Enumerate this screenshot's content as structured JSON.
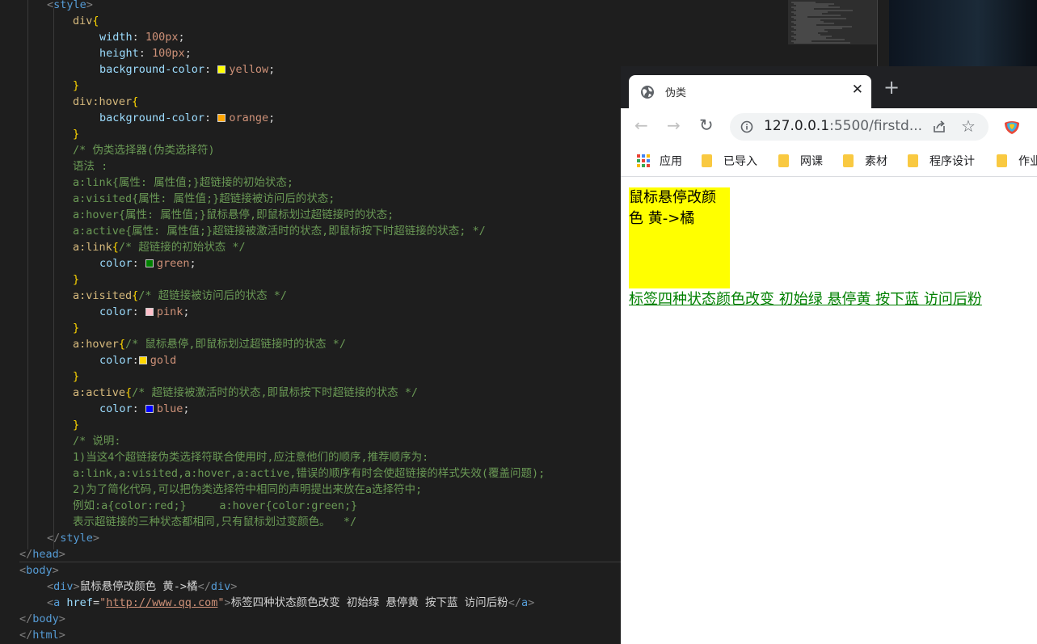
{
  "editor": {
    "lines": [
      [
        {
          "c": "t-br",
          "t": "<"
        },
        {
          "c": "t-tag",
          "t": "style"
        },
        {
          "c": "t-br",
          "t": ">"
        }
      ],
      [
        {
          "c": "t-sel",
          "t": "div"
        },
        {
          "c": "t-brace",
          "t": "{"
        }
      ],
      [
        {
          "c": "t-prop",
          "t": "width"
        },
        {
          "c": "t-txt",
          "t": ": "
        },
        {
          "c": "t-val",
          "t": "100px"
        },
        {
          "c": "t-txt",
          "t": ";"
        }
      ],
      [
        {
          "c": "t-prop",
          "t": "height"
        },
        {
          "c": "t-txt",
          "t": ": "
        },
        {
          "c": "t-val",
          "t": "100px"
        },
        {
          "c": "t-txt",
          "t": ";"
        }
      ],
      [
        {
          "c": "t-prop",
          "t": "background-color"
        },
        {
          "c": "t-txt",
          "t": ": "
        },
        {
          "sw": "#ffff00"
        },
        {
          "c": "t-val",
          "t": "yellow"
        },
        {
          "c": "t-txt",
          "t": ";"
        }
      ],
      [
        {
          "c": "t-brace",
          "t": "}"
        }
      ],
      [
        {
          "c": "t-sel",
          "t": "div:hover"
        },
        {
          "c": "t-brace",
          "t": "{"
        }
      ],
      [
        {
          "c": "t-prop",
          "t": "background-color"
        },
        {
          "c": "t-txt",
          "t": ": "
        },
        {
          "sw": "#ffa500"
        },
        {
          "c": "t-val",
          "t": "orange"
        },
        {
          "c": "t-txt",
          "t": ";"
        }
      ],
      [
        {
          "c": "t-brace",
          "t": "}"
        }
      ],
      [
        {
          "c": "t-com",
          "t": "/* 伪类选择器(伪类选择符)"
        }
      ],
      [
        {
          "c": "t-com",
          "t": "语法 :"
        }
      ],
      [
        {
          "c": "t-com",
          "t": "a:link{属性: 属性值;}超链接的初始状态;"
        }
      ],
      [
        {
          "c": "t-com",
          "t": "a:visited{属性: 属性值;}超链接被访问后的状态;"
        }
      ],
      [
        {
          "c": "t-com",
          "t": "a:hover{属性: 属性值;}鼠标悬停,即鼠标划过超链接时的状态;"
        }
      ],
      [
        {
          "c": "t-com",
          "t": "a:active{属性: 属性值;}超链接被激活时的状态,即鼠标按下时超链接的状态; */"
        }
      ],
      [
        {
          "c": "t-sel",
          "t": "a:link"
        },
        {
          "c": "t-brace",
          "t": "{"
        },
        {
          "c": "t-com",
          "t": "/* 超链接的初始状态 */"
        }
      ],
      [
        {
          "c": "t-prop",
          "t": "color"
        },
        {
          "c": "t-txt",
          "t": ": "
        },
        {
          "sw": "#008000"
        },
        {
          "c": "t-val",
          "t": "green"
        },
        {
          "c": "t-txt",
          "t": ";"
        }
      ],
      [
        {
          "c": "t-brace",
          "t": "}"
        }
      ],
      [
        {
          "c": "t-sel",
          "t": "a:visited"
        },
        {
          "c": "t-brace",
          "t": "{"
        },
        {
          "c": "t-com",
          "t": "/* 超链接被访问后的状态 */"
        }
      ],
      [
        {
          "c": "t-prop",
          "t": "color"
        },
        {
          "c": "t-txt",
          "t": ": "
        },
        {
          "sw": "#ffc0cb"
        },
        {
          "c": "t-val",
          "t": "pink"
        },
        {
          "c": "t-txt",
          "t": ";"
        }
      ],
      [
        {
          "c": "t-brace",
          "t": "}"
        }
      ],
      [
        {
          "c": "t-sel",
          "t": "a:hover"
        },
        {
          "c": "t-brace",
          "t": "{"
        },
        {
          "c": "t-com",
          "t": "/* 鼠标悬停,即鼠标划过超链接时的状态 */"
        }
      ],
      [
        {
          "c": "t-prop",
          "t": "color"
        },
        {
          "c": "t-txt",
          "t": ":"
        },
        {
          "sw": "#ffd700"
        },
        {
          "c": "t-val",
          "t": "gold"
        }
      ],
      [
        {
          "c": "t-brace",
          "t": "}"
        }
      ],
      [
        {
          "c": "t-sel",
          "t": "a:active"
        },
        {
          "c": "t-brace",
          "t": "{"
        },
        {
          "c": "t-com",
          "t": "/* 超链接被激活时的状态,即鼠标按下时超链接的状态 */"
        }
      ],
      [
        {
          "c": "t-prop",
          "t": "color"
        },
        {
          "c": "t-txt",
          "t": ": "
        },
        {
          "sw": "#0000ff"
        },
        {
          "c": "t-val",
          "t": "blue"
        },
        {
          "c": "t-txt",
          "t": ";"
        }
      ],
      [
        {
          "c": "t-brace",
          "t": "}"
        }
      ],
      [
        {
          "c": "t-com",
          "t": "/* 说明:"
        }
      ],
      [
        {
          "c": "t-com",
          "t": "1)当这4个超链接伪类选择符联合使用时,应注意他们的顺序,推荐顺序为:"
        }
      ],
      [
        {
          "c": "t-com",
          "t": "a:link,a:visited,a:hover,a:active,错误的顺序有时会使超链接的样式失效(覆盖问题);"
        }
      ],
      [
        {
          "c": "t-com",
          "t": "2)为了简化代码,可以把伪类选择符中相同的声明提出来放在a选择符中;"
        }
      ],
      [
        {
          "c": "t-com",
          "t": "例如:a{color:red;}     a:hover{color:green;}"
        }
      ],
      [
        {
          "c": "t-com",
          "t": "表示超链接的三种状态都相同,只有鼠标划过变颜色。  */"
        }
      ],
      [
        {
          "c": "t-br",
          "t": "</"
        },
        {
          "c": "t-tag",
          "t": "style"
        },
        {
          "c": "t-br",
          "t": ">"
        }
      ],
      [
        {
          "c": "t-br",
          "t": "</"
        },
        {
          "c": "t-tag",
          "t": "head"
        },
        {
          "c": "t-br",
          "t": ">"
        }
      ],
      [
        {
          "c": "t-br",
          "t": "<"
        },
        {
          "c": "t-tag",
          "t": "body"
        },
        {
          "c": "t-br",
          "t": ">"
        }
      ],
      [
        {
          "c": "t-br",
          "t": "<"
        },
        {
          "c": "t-tag",
          "t": "div"
        },
        {
          "c": "t-br",
          "t": ">"
        },
        {
          "c": "t-txt",
          "t": "鼠标悬停改颜色 黄->橘"
        },
        {
          "c": "t-br",
          "t": "</"
        },
        {
          "c": "t-tag",
          "t": "div"
        },
        {
          "c": "t-br",
          "t": ">"
        }
      ],
      [
        {
          "c": "t-br",
          "t": "<"
        },
        {
          "c": "t-tag",
          "t": "a"
        },
        {
          "c": "t-txt",
          "t": " "
        },
        {
          "c": "t-attr",
          "t": "href"
        },
        {
          "c": "t-txt",
          "t": "="
        },
        {
          "c": "t-val",
          "t": "\""
        },
        {
          "c": "t-str",
          "t": "http://www.qq.com"
        },
        {
          "c": "t-val",
          "t": "\""
        },
        {
          "c": "t-br",
          "t": ">"
        },
        {
          "c": "t-txt",
          "t": "标签四种状态颜色改变 初始绿 悬停黄 按下蓝 访问后粉"
        },
        {
          "c": "t-br",
          "t": "</"
        },
        {
          "c": "t-tag",
          "t": "a"
        },
        {
          "c": "t-br",
          "t": ">"
        }
      ],
      [
        {
          "c": "t-br",
          "t": "</"
        },
        {
          "c": "t-tag",
          "t": "body"
        },
        {
          "c": "t-br",
          "t": ">"
        }
      ],
      [
        {
          "c": "t-br",
          "t": "</"
        },
        {
          "c": "t-tag",
          "t": "html"
        },
        {
          "c": "t-br",
          "t": ">"
        }
      ]
    ]
  },
  "browser": {
    "tab_title": "伪类",
    "tab_close": "✕",
    "new_tab": "+",
    "url_host": "127.0.0.1",
    "url_rest": ":5500/firstd...",
    "star": "☆",
    "back": "←",
    "forward": "→",
    "reload": "↻",
    "bookmarks": [
      {
        "label": "应用",
        "icon": "apps-grid-icon"
      },
      {
        "label": "已导入",
        "icon": "folder-icon"
      },
      {
        "label": "网课",
        "icon": "folder-icon"
      },
      {
        "label": "素材",
        "icon": "folder-icon"
      },
      {
        "label": "程序设计",
        "icon": "folder-icon"
      },
      {
        "label": "作业",
        "icon": "folder-icon"
      }
    ],
    "page": {
      "div_text": "鼠标悬停改颜色 黄->橘",
      "link_text": "标签四种状态颜色改变 初始绿 悬停黄 按下蓝 访问后粉",
      "div_color": "#ffff00",
      "link_color": "#008000"
    }
  }
}
